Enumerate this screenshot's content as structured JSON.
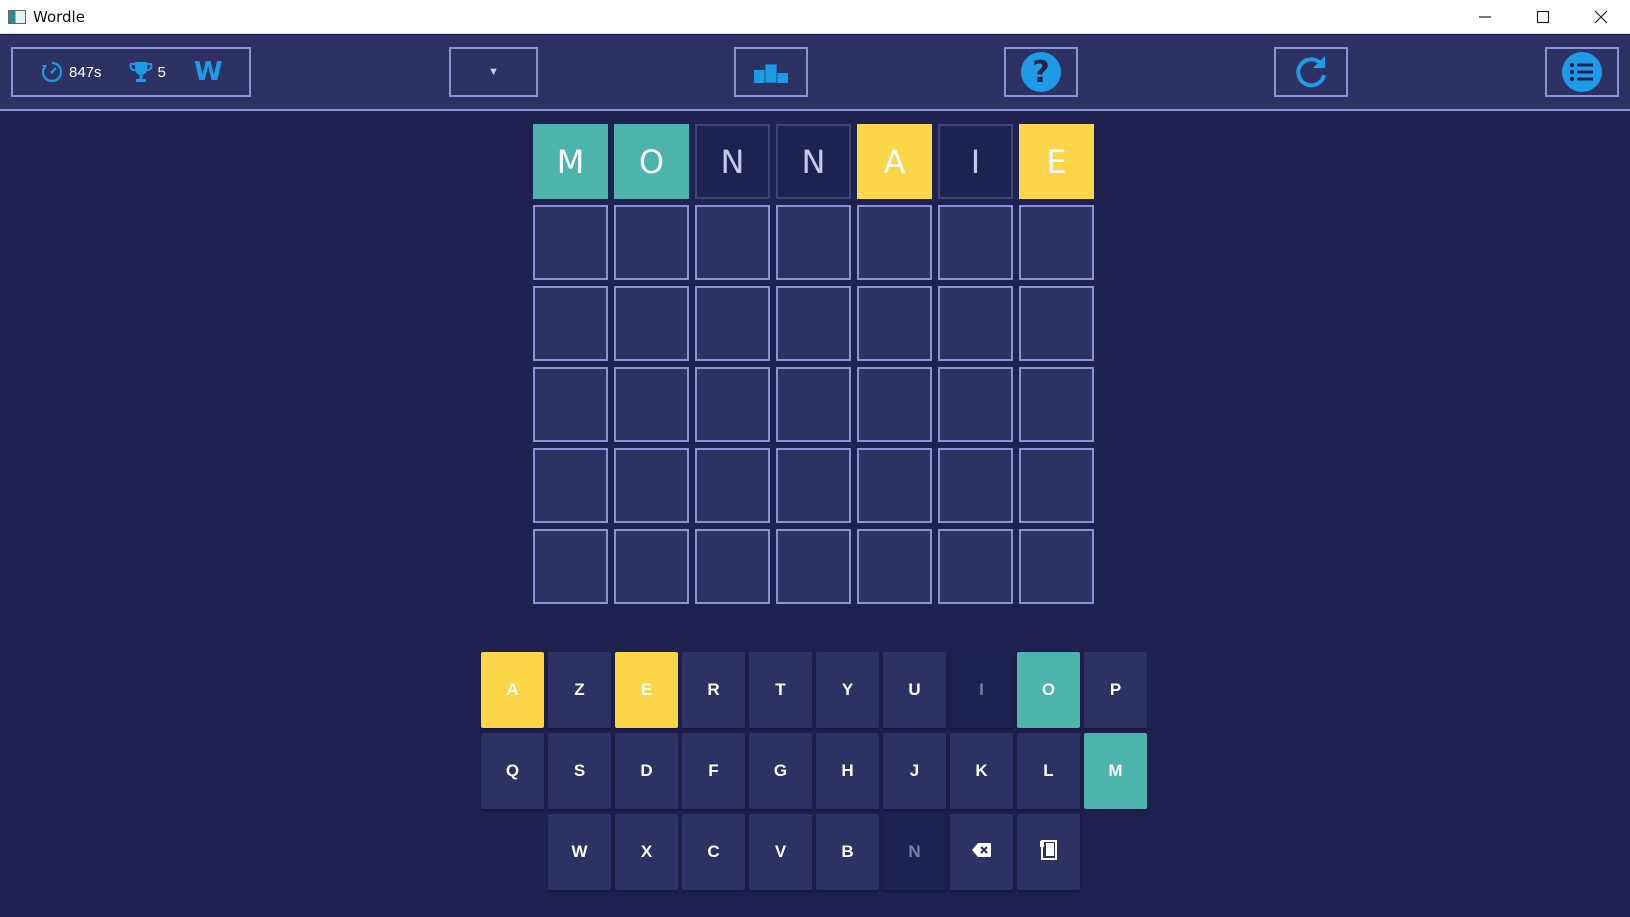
{
  "window": {
    "title": "Wordle"
  },
  "toolbar": {
    "timer": "847s",
    "trophies": "5",
    "mode_letter": "W",
    "dropdown_value": "",
    "help_glyph": "?"
  },
  "colors": {
    "background": "#1f2250",
    "tile_empty": "#2d3163",
    "correct": "#4cb3ad",
    "present": "#fcd549",
    "absent": "#1e2250",
    "accent": "#1e9be6",
    "border": "#8b93d6"
  },
  "grid": {
    "rows": [
      {
        "letters": [
          "M",
          "O",
          "N",
          "N",
          "A",
          "I",
          "E"
        ],
        "states": [
          "correct",
          "correct",
          "absent",
          "absent",
          "present",
          "absent",
          "present"
        ]
      },
      {
        "letters": [
          "",
          "",
          "",
          "",
          "",
          "",
          ""
        ],
        "states": [
          "empty",
          "empty",
          "empty",
          "empty",
          "empty",
          "empty",
          "empty"
        ]
      },
      {
        "letters": [
          "",
          "",
          "",
          "",
          "",
          "",
          ""
        ],
        "states": [
          "empty",
          "empty",
          "empty",
          "empty",
          "empty",
          "empty",
          "empty"
        ]
      },
      {
        "letters": [
          "",
          "",
          "",
          "",
          "",
          "",
          ""
        ],
        "states": [
          "empty",
          "empty",
          "empty",
          "empty",
          "empty",
          "empty",
          "empty"
        ]
      },
      {
        "letters": [
          "",
          "",
          "",
          "",
          "",
          "",
          ""
        ],
        "states": [
          "empty",
          "empty",
          "empty",
          "empty",
          "empty",
          "empty",
          "empty"
        ]
      },
      {
        "letters": [
          "",
          "",
          "",
          "",
          "",
          "",
          ""
        ],
        "states": [
          "empty",
          "empty",
          "empty",
          "empty",
          "empty",
          "empty",
          "empty"
        ]
      }
    ]
  },
  "keyboard": {
    "rows": [
      [
        {
          "key": "A",
          "state": "present"
        },
        {
          "key": "Z",
          "state": "unused"
        },
        {
          "key": "E",
          "state": "present"
        },
        {
          "key": "R",
          "state": "unused"
        },
        {
          "key": "T",
          "state": "unused"
        },
        {
          "key": "Y",
          "state": "unused"
        },
        {
          "key": "U",
          "state": "unused"
        },
        {
          "key": "I",
          "state": "absent"
        },
        {
          "key": "O",
          "state": "correct"
        },
        {
          "key": "P",
          "state": "unused"
        }
      ],
      [
        {
          "key": "Q",
          "state": "unused"
        },
        {
          "key": "S",
          "state": "unused"
        },
        {
          "key": "D",
          "state": "unused"
        },
        {
          "key": "F",
          "state": "unused"
        },
        {
          "key": "G",
          "state": "unused"
        },
        {
          "key": "H",
          "state": "unused"
        },
        {
          "key": "J",
          "state": "unused"
        },
        {
          "key": "K",
          "state": "unused"
        },
        {
          "key": "L",
          "state": "unused"
        },
        {
          "key": "M",
          "state": "correct"
        }
      ],
      [
        {
          "key": "W",
          "state": "unused"
        },
        {
          "key": "X",
          "state": "unused"
        },
        {
          "key": "C",
          "state": "unused"
        },
        {
          "key": "V",
          "state": "unused"
        },
        {
          "key": "B",
          "state": "unused"
        },
        {
          "key": "N",
          "state": "absent"
        },
        {
          "key": "",
          "icon": "backspace-icon",
          "state": "unused"
        },
        {
          "key": "",
          "icon": "enter-icon",
          "state": "unused"
        }
      ]
    ]
  }
}
